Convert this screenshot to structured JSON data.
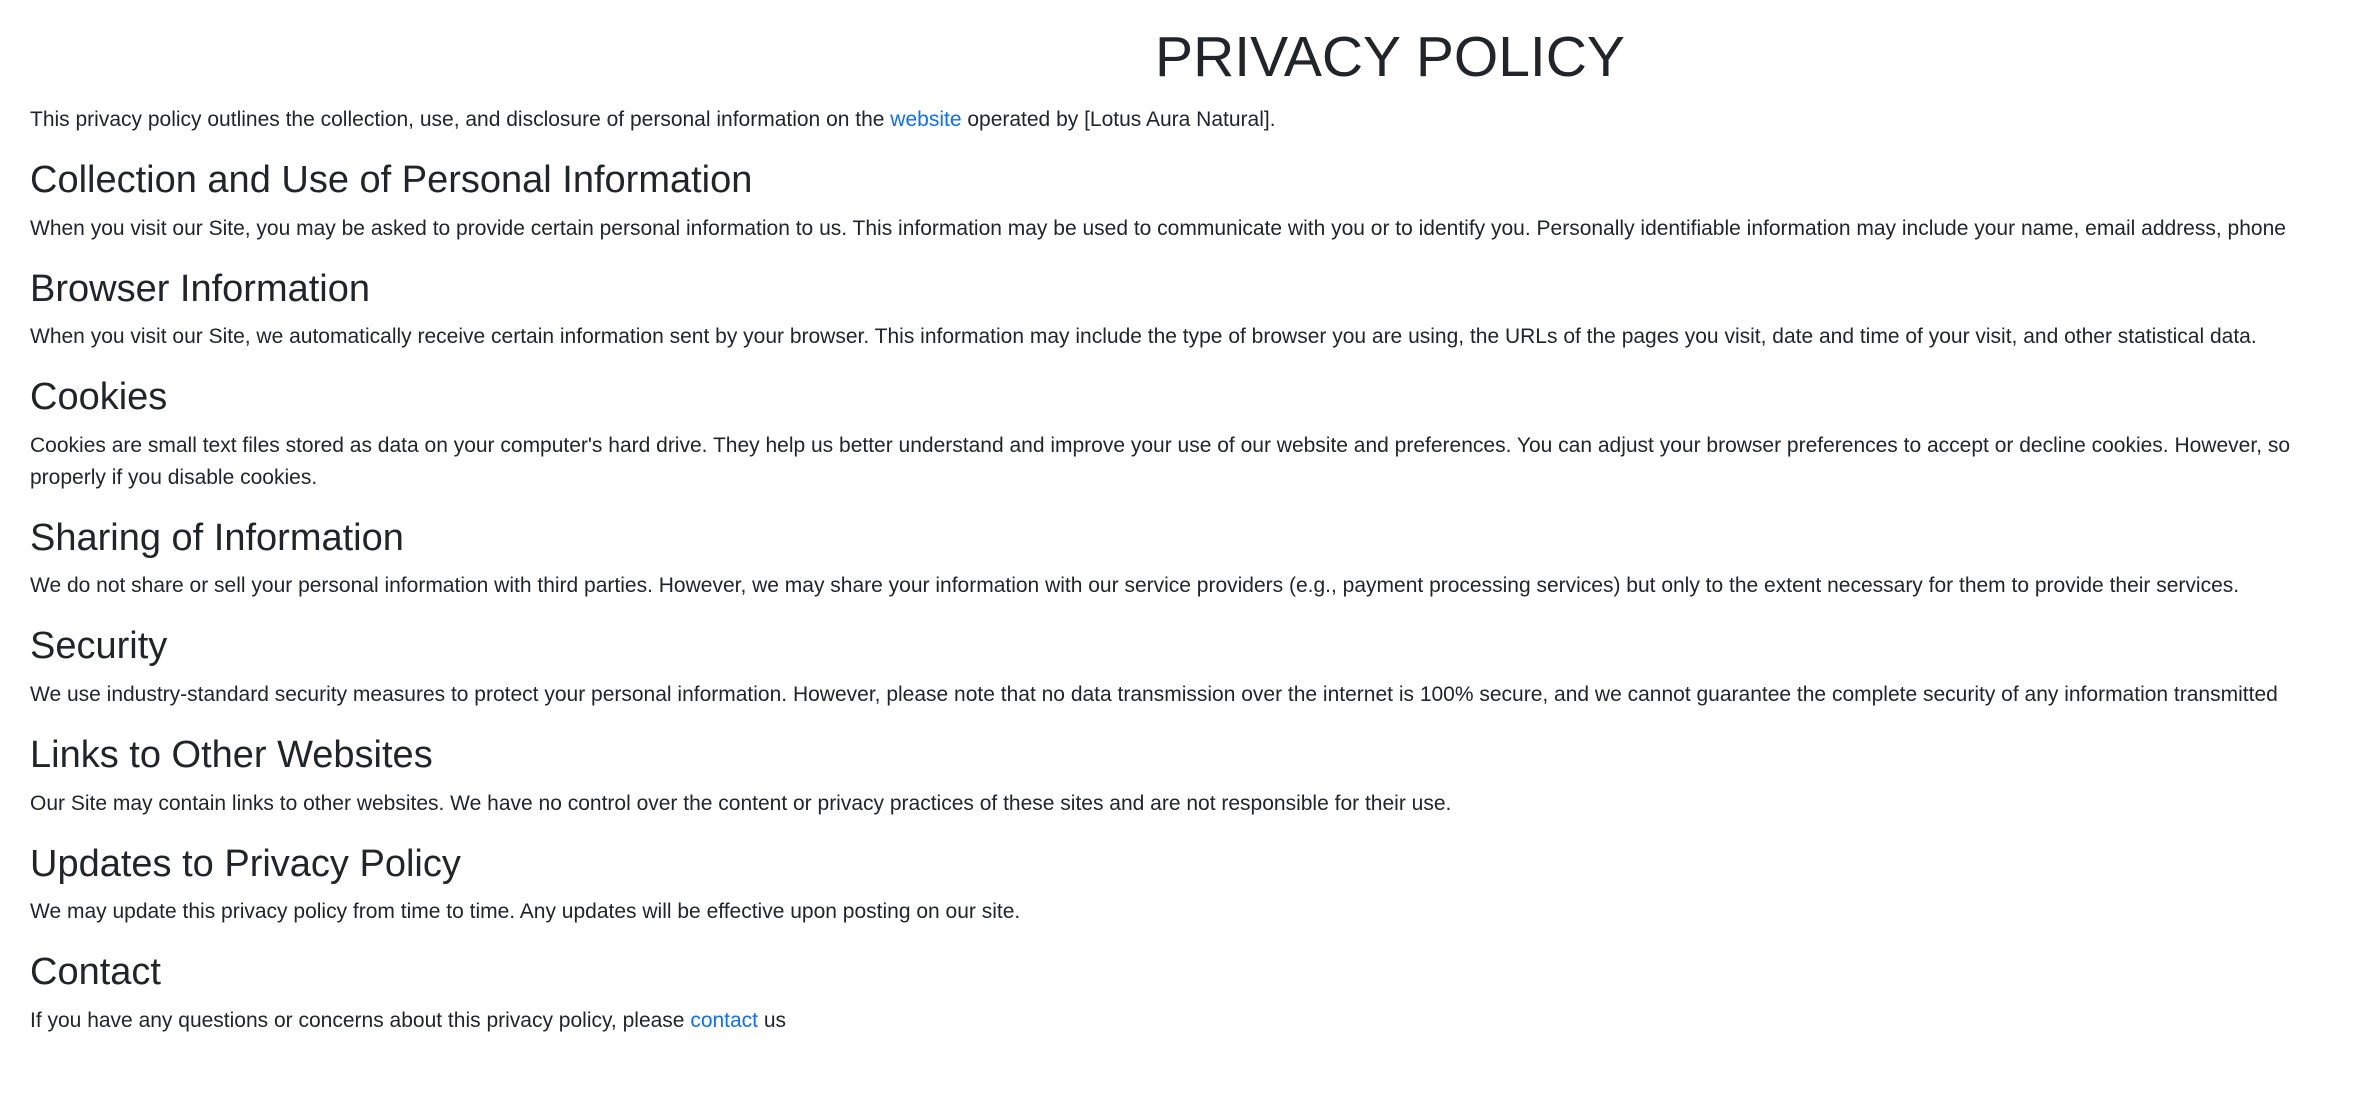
{
  "page": {
    "title": "PRIVACY POLICY",
    "intro": {
      "before": "This privacy policy outlines the collection, use, and disclosure of personal information on the ",
      "link_text": "website",
      "after": " operated by [Lotus Aura Natural]."
    }
  },
  "sections": [
    {
      "heading": "Collection and Use of Personal Information",
      "text": "When you visit our Site, you may be asked to provide certain personal information to us. This information may be used to communicate with you or to identify you. Personally identifiable information may include your name, email address, phone"
    },
    {
      "heading": "Browser Information",
      "text": "When you visit our Site, we automatically receive certain information sent by your browser. This information may include the type of browser you are using, the URLs of the pages you visit, date and time of your visit, and other statistical data."
    },
    {
      "heading": "Cookies",
      "text_line1": "Cookies are small text files stored as data on your computer's hard drive. They help us better understand and improve your use of our website and preferences. You can adjust your browser preferences to accept or decline cookies. However, so",
      "text_line2": "properly if you disable cookies."
    },
    {
      "heading": "Sharing of Information",
      "text": "We do not share or sell your personal information with third parties. However, we may share your information with our service providers (e.g., payment processing services) but only to the extent necessary for them to provide their services."
    },
    {
      "heading": "Security",
      "text": "We use industry-standard security measures to protect your personal information. However, please note that no data transmission over the internet is 100% secure, and we cannot guarantee the complete security of any information transmitted"
    },
    {
      "heading": "Links to Other Websites",
      "text": "Our Site may contain links to other websites. We have no control over the content or privacy practices of these sites and are not responsible for their use."
    },
    {
      "heading": "Updates to Privacy Policy",
      "text": "We may update this privacy policy from time to time. Any updates will be effective upon posting on our site."
    },
    {
      "heading": "Contact",
      "text_before": "If you have any questions or concerns about this privacy policy, please ",
      "link_text": "contact",
      "text_after": " us"
    }
  ],
  "colors": {
    "text": "#212529",
    "link": "#0d6efd",
    "background": "#ffffff"
  }
}
